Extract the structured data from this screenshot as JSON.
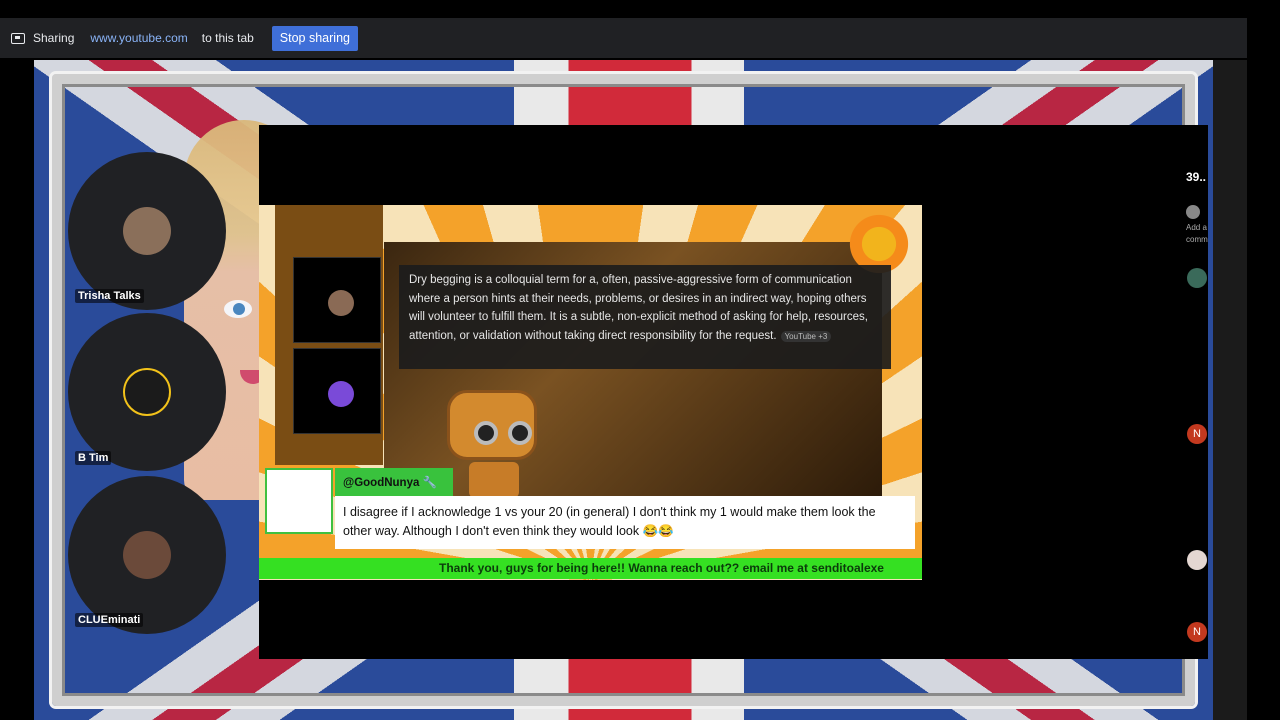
{
  "share_bar": {
    "sharing_label": "Sharing",
    "url": "www.youtube.com",
    "tab_label": "to this tab",
    "stop_button": "Stop sharing"
  },
  "participants": [
    {
      "name": "Trisha Talks",
      "avatar_color": "#8a6f5a"
    },
    {
      "name": "B Tim",
      "avatar_color": "#1b1b1b"
    },
    {
      "name": "CLUEminati",
      "avatar_color": "#6b4a3a"
    }
  ],
  "video": {
    "definition_text": "Dry begging is a colloquial term for a, often, passive-aggressive form of communication where a person hints at their needs, problems, or desires in an indirect way, hoping others will volunteer to fulfill them. It is a subtle, non-explicit method of asking for help, resources, attention, or validation without taking direct responsibility for the request.",
    "source_chip": "YouTube +3",
    "comment_user": "@GoodNunya 🔧",
    "comment_text": "I disagree if I acknowledge 1 vs your 20 (in general) I don't think my 1 would make them look the other way. Although I don't even think they would look 😂😂",
    "ticker_text": "Thank you, guys for being here!! Wanna reach out?? email me at senditoalexe"
  },
  "chat_panel": {
    "count": "39..",
    "add_text_1": "Add a",
    "add_text_2": "comm",
    "avatar_letter": "N"
  },
  "colors": {
    "stop_button": "#3f6fd8",
    "ticker_green": "#35e022",
    "comment_green": "#39c23d"
  }
}
